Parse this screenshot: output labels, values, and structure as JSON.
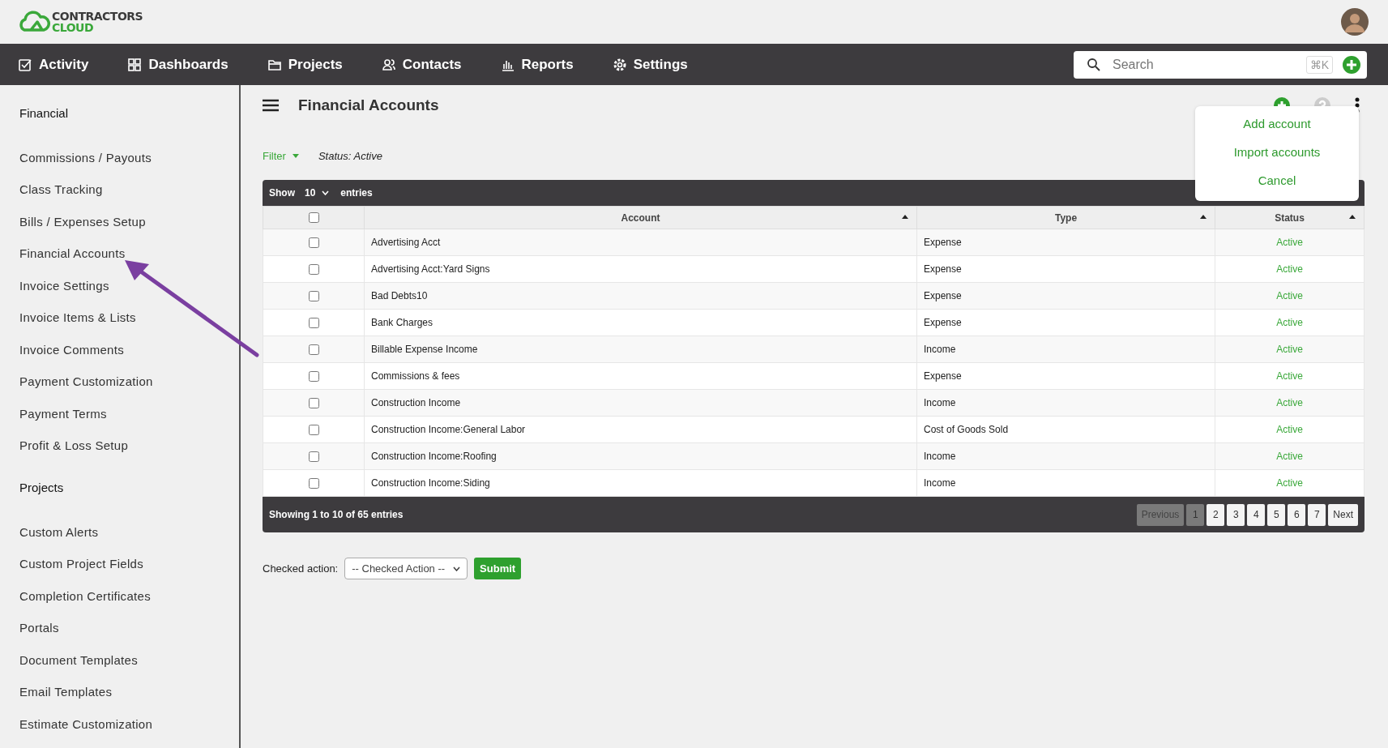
{
  "logo": {
    "line_1": "CONTRACTORS",
    "line_2": "CLOUD"
  },
  "nav": [
    "Activity",
    "Dashboards",
    "Projects",
    "Contacts",
    "Reports",
    "Settings"
  ],
  "search": {
    "placeholder": "Search",
    "shortcut": "⌘K"
  },
  "sidebar": [
    {
      "heading": "Financial",
      "items": [
        {
          "label": "Commissions / Payouts",
          "selected": false
        },
        {
          "label": "Class Tracking",
          "selected": false
        },
        {
          "label": "Bills / Expenses Setup",
          "selected": false
        },
        {
          "label": "Financial Accounts",
          "selected": false
        },
        {
          "label": "Invoice Settings",
          "selected": false
        },
        {
          "label": "Invoice Items & Lists",
          "selected": false
        },
        {
          "label": "Invoice Comments",
          "selected": false
        },
        {
          "label": "Payment Customization",
          "selected": false
        },
        {
          "label": "Payment Terms",
          "selected": false
        },
        {
          "label": "Profit & Loss Setup",
          "selected": false
        }
      ]
    },
    {
      "heading": "Projects",
      "items": [
        {
          "label": "Custom Alerts",
          "selected": false
        },
        {
          "label": "Custom Project Fields",
          "selected": false
        },
        {
          "label": "Completion Certificates",
          "selected": false
        },
        {
          "label": "Portals",
          "selected": false
        },
        {
          "label": "Document Templates",
          "selected": false
        },
        {
          "label": "Email Templates",
          "selected": false
        },
        {
          "label": "Estimate Customization",
          "selected": false
        }
      ]
    }
  ],
  "page_title": "Financial Accounts",
  "menu": [
    "Add account",
    "Import accounts",
    "Cancel"
  ],
  "filter": {
    "label": "Filter",
    "status": "Status: Active"
  },
  "table": {
    "show": "Show",
    "page_size": "10",
    "entries": "entries",
    "select_all_checked": false,
    "columns": [
      "Account",
      "Type",
      "Status"
    ],
    "rows": [
      {
        "checked": false,
        "account": "Advertising Acct",
        "type": "Expense",
        "status": "Active"
      },
      {
        "checked": false,
        "account": "Advertising Acct:Yard Signs",
        "type": "Expense",
        "status": "Active"
      },
      {
        "checked": false,
        "account": "Bad Debts10",
        "type": "Expense",
        "status": "Active"
      },
      {
        "checked": false,
        "account": "Bank Charges",
        "type": "Expense",
        "status": "Active"
      },
      {
        "checked": false,
        "account": "Billable Expense Income",
        "type": "Income",
        "status": "Active"
      },
      {
        "checked": false,
        "account": "Commissions & fees",
        "type": "Expense",
        "status": "Active"
      },
      {
        "checked": false,
        "account": "Construction Income",
        "type": "Income",
        "status": "Active"
      },
      {
        "checked": false,
        "account": "Construction Income:General Labor",
        "type": "Cost of Goods Sold",
        "status": "Active"
      },
      {
        "checked": false,
        "account": "Construction Income:Roofing",
        "type": "Income",
        "status": "Active"
      },
      {
        "checked": false,
        "account": "Construction Income:Siding",
        "type": "Income",
        "status": "Active"
      }
    ],
    "info": "Showing 1 to 10 of 65 entries",
    "previous": {
      "label": "Previous",
      "disabled": true
    },
    "pages": [
      {
        "label": "1",
        "selected": true
      },
      {
        "label": "2",
        "selected": false
      },
      {
        "label": "3",
        "selected": false
      },
      {
        "label": "4",
        "selected": false
      },
      {
        "label": "5",
        "selected": false
      },
      {
        "label": "6",
        "selected": false
      },
      {
        "label": "7",
        "selected": false
      }
    ],
    "next": {
      "label": "Next",
      "disabled": false
    }
  },
  "checked_action": {
    "label": "Checked action:",
    "value": "-- Checked Action --",
    "button": "Submit"
  }
}
